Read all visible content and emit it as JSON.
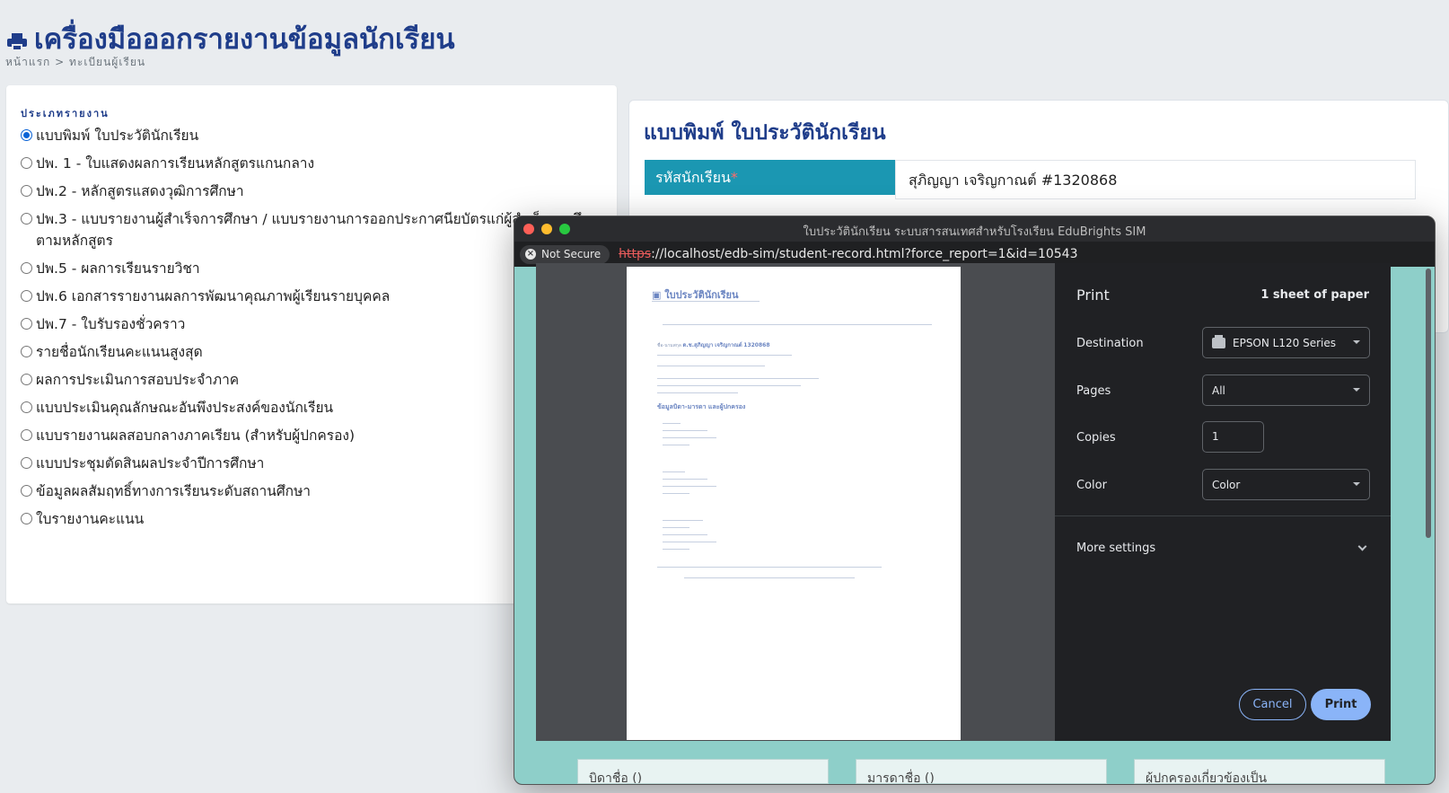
{
  "header": {
    "title": "เครื่องมือออกรายงานข้อมูลนักเรียน",
    "breadcrumb": "หน้าแรก > ทะเบียนผู้เรียน"
  },
  "report_types": {
    "label": "ประเภทรายงาน",
    "items": [
      {
        "label": "แบบพิมพ์ ใบประวัตินักเรียน",
        "checked": true
      },
      {
        "label": "ปพ. 1 - ใบแสดงผลการเรียนหลักสูตรแกนกลาง",
        "checked": false
      },
      {
        "label": "ปพ.2 - หลักสูตรแสดงวุฒิการศึกษา",
        "checked": false
      },
      {
        "label": "ปพ.3 - แบบรายงานผู้สำเร็จการศึกษา / แบบรายงานการออกประกาศนียบัตรแก่ผู้สำเร็จการศึกษา ตามหลักสูตร",
        "checked": false
      },
      {
        "label": "ปพ.5 - ผลการเรียนรายวิชา",
        "checked": false
      },
      {
        "label": "ปพ.6 เอกสารรายงานผลการพัฒนาคุณภาพผู้เรียนรายบุคคล",
        "checked": false
      },
      {
        "label": "ปพ.7 - ใบรับรองชั่วคราว",
        "checked": false
      },
      {
        "label": "รายชื่อนักเรียนคะแนนสูงสุด",
        "checked": false
      },
      {
        "label": "ผลการประเมินการสอบประจำภาค",
        "checked": false
      },
      {
        "label": "แบบประเมินคุณลักษณะอันพึงประสงค์ของนักเรียน",
        "checked": false
      },
      {
        "label": "แบบรายงานผลสอบกลางภาคเรียน (สำหรับผู้ปกครอง)",
        "checked": false
      },
      {
        "label": "แบบประชุมตัดสินผลประจำปีการศึกษา",
        "checked": false
      },
      {
        "label": "ข้อมูลผลสัมฤทธิ์ทางการเรียนระดับสถานศึกษา",
        "checked": false
      },
      {
        "label": "ใบรายงานคะแนน",
        "checked": false
      }
    ]
  },
  "form": {
    "title": "แบบพิมพ์ ใบประวัตินักเรียน",
    "student_id_label": "รหัสนักเรียน",
    "required_mark": "*",
    "student_id_value": "สุภิญญา เจริญกาณต์ #1320868"
  },
  "popup": {
    "window_title": "ใบประวัตินักเรียน ระบบสารสนเทศสำหรับโรงเรียน EduBrights SIM",
    "not_secure": "Not Secure",
    "url_scheme": "https",
    "url_rest": "://localhost/edb-sim/student-record.html?force_report=1&id=10543",
    "behind_cells": [
      "บิดาชื่อ ()",
      "มารดาชื่อ ()",
      "ผู้ปกครองเกี่ยวข้องเป็น"
    ]
  },
  "preview": {
    "title": "ใบประวัตินักเรียน",
    "student_line": "ด.ช.สุภิญญา เจริญกาณต์",
    "student_code": "1320868",
    "section_parents": "ข้อมูลบิดา-มารดา และผู้ปกครอง"
  },
  "print_dialog": {
    "title": "Print",
    "sheets": "1 sheet of paper",
    "destination_label": "Destination",
    "destination_value": "EPSON L120 Series",
    "pages_label": "Pages",
    "pages_value": "All",
    "copies_label": "Copies",
    "copies_value": "1",
    "color_label": "Color",
    "color_value": "Color",
    "more_settings": "More settings",
    "cancel": "Cancel",
    "print": "Print"
  },
  "colors": {
    "brand": "#1f3d8a",
    "accent_teal": "#1b97b2",
    "print_button": "#8ab4f8"
  }
}
